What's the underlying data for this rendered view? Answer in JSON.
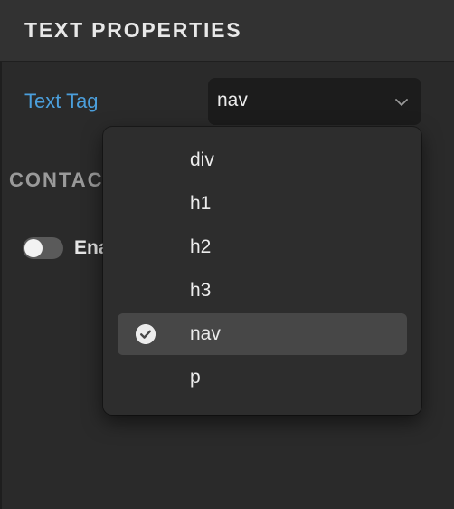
{
  "section": {
    "title": "TEXT PROPERTIES"
  },
  "text_tag": {
    "label": "Text Tag",
    "selected_value": "nav",
    "options": [
      {
        "label": "div",
        "selected": false
      },
      {
        "label": "h1",
        "selected": false
      },
      {
        "label": "h2",
        "selected": false
      },
      {
        "label": "h3",
        "selected": false
      },
      {
        "label": "nav",
        "selected": true
      },
      {
        "label": "p",
        "selected": false
      }
    ]
  },
  "sub_section": {
    "title_visible": "CONTAC"
  },
  "toggle": {
    "label_visible": "Ena",
    "on": false
  },
  "colors": {
    "accent_label": "#4b9fdc",
    "panel_bg": "#2a2a2a",
    "dropdown_bg": "#2d2d2d",
    "selected_row_bg": "#474747"
  },
  "icons": {
    "select_chevron": "chevron-down-icon",
    "selected_mark": "checkmark-circle-icon"
  }
}
